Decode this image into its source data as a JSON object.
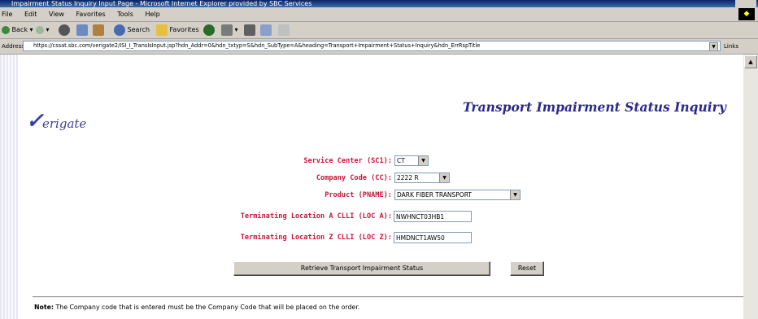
{
  "window": {
    "title": "Impairment Status Inquiry Input Page - Microsoft Internet Explorer provided by SBC Services"
  },
  "menu": {
    "items": [
      "File",
      "Edit",
      "View",
      "Favorites",
      "Tools",
      "Help"
    ]
  },
  "toolbar": {
    "back_label": "Back",
    "search_label": "Search",
    "favorites_label": "Favorites"
  },
  "address_bar": {
    "label": "Address",
    "url": "https://cssat.sbc.com/verigate2/ISI_I_TransIsInput.jsp?hdn_Addr=0&hdn_txtyp=S&hdn_SubType=A&heading=Transport+Impairment+Status+Inquiry&hdn_ErrRspTitle",
    "links_label": "Links"
  },
  "page": {
    "logo_text": "erigate",
    "heading": "Transport Impairment Status Inquiry",
    "form": {
      "service_center_label": "Service Center (SC1):",
      "service_center_value": "CT",
      "company_code_label": "Company Code (CC):",
      "company_code_value": "2222 R",
      "product_label": "Product (PNAME):",
      "product_value": "DARK FIBER TRANSPORT",
      "loc_a_label": "Terminating Location A CLLI (LOC A):",
      "loc_a_value": "NWHNCT03HB1",
      "loc_z_label": "Terminating Location Z CLLI (LOC Z):",
      "loc_z_value": "HMDNCT1AW50"
    },
    "retrieve_button": "Retrieve Transport Impairment Status",
    "reset_button": "Reset",
    "note_label": "Note:",
    "note_text": "The Company code that is entered must be the Company Code that will be placed on the order."
  },
  "colors": {
    "label_red": "#c8163a",
    "heading_blue": "#2b2a8a"
  }
}
